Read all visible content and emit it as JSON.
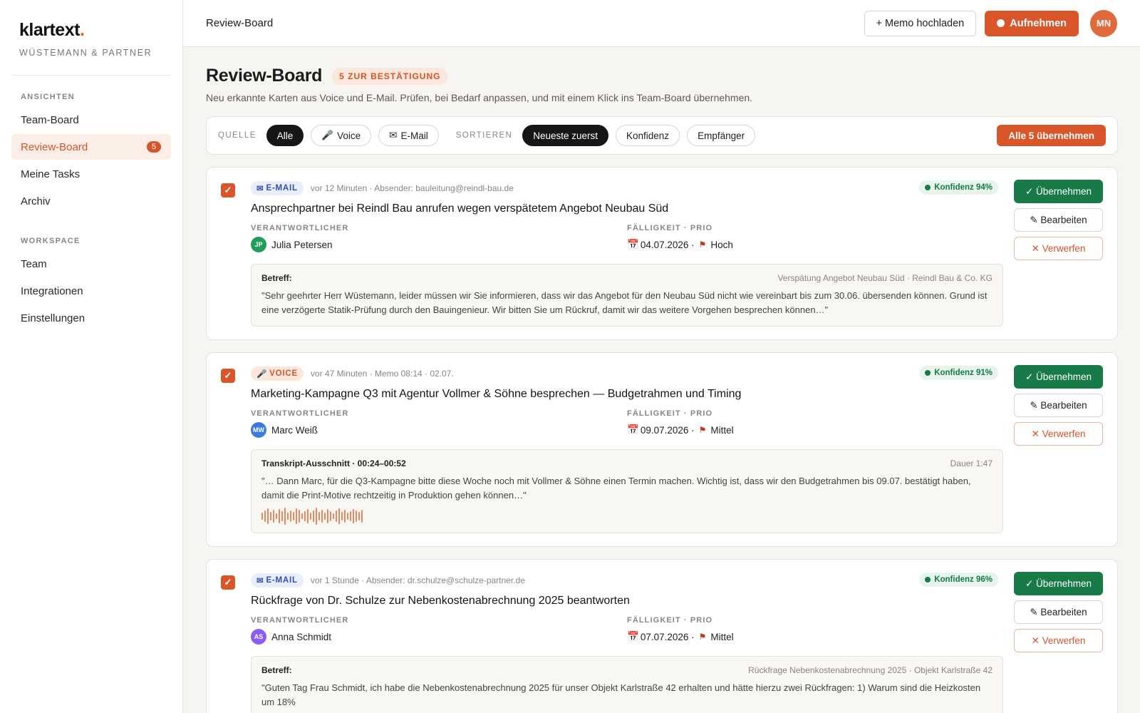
{
  "brand": {
    "logo": "klartext",
    "logo_dot": ".",
    "company": "WÜSTEMANN & PARTNER"
  },
  "sidebar": {
    "groups": [
      {
        "heading": "ANSICHTEN",
        "items": [
          {
            "label": "Team-Board"
          },
          {
            "label": "Review-Board",
            "badge": "5",
            "active": true
          },
          {
            "label": "Meine Tasks"
          },
          {
            "label": "Archiv"
          }
        ]
      },
      {
        "heading": "WORKSPACE",
        "items": [
          {
            "label": "Team"
          },
          {
            "label": "Integrationen"
          },
          {
            "label": "Einstellungen"
          }
        ]
      }
    ]
  },
  "topbar": {
    "title": "Review-Board",
    "upload_label": "+ Memo hochladen",
    "record_label": "Aufnehmen",
    "avatar": "MN"
  },
  "page": {
    "title": "Review-Board",
    "badge": "5 ZUR BESTÄTIGUNG",
    "subtitle": "Neu erkannte Karten aus Voice und E-Mail. Prüfen, bei Bedarf anpassen, und mit einem Klick ins Team-Board übernehmen."
  },
  "filters": {
    "source_label": "QUELLE",
    "source_options": [
      {
        "label": "Alle",
        "icon": "",
        "active": true
      },
      {
        "label": "Voice",
        "icon": "🎤",
        "active": false
      },
      {
        "label": "E-Mail",
        "icon": "✉",
        "active": false
      }
    ],
    "sort_label": "SORTIEREN",
    "sort_options": [
      {
        "label": "Neueste zuerst",
        "active": true
      },
      {
        "label": "Konfidenz",
        "active": false
      },
      {
        "label": "Empfänger",
        "active": false
      }
    ],
    "accept_all_label": "Alle 5 übernehmen"
  },
  "card_labels": {
    "owner": "VERANTWORTLICHER",
    "due": "FÄLLIGKEIT · PRIO",
    "accept": "✓ Übernehmen",
    "edit": "✎ Bearbeiten",
    "reject": "✕ Verwerfen",
    "calendar_icon": "📅",
    "flag_icon": "⚑"
  },
  "cards": [
    {
      "type": "email",
      "source_icon": "✉",
      "source_label": "E-MAIL",
      "meta": "vor 12 Minuten · Absender: bauleitung@reindl-bau.de",
      "confidence": "Konfidenz 94%",
      "title": "Ansprechpartner bei Reindl Bau anrufen wegen verspätetem Angebot Neubau Süd",
      "owner_initials": "JP",
      "owner_color": "#1f9d5b",
      "owner_name": "Julia Petersen",
      "due": "04.07.2026 ·",
      "prio": "Hoch",
      "quote_label": "Betreff:",
      "quote_ref": "Verspätung Angebot Neubau Süd · Reindl Bau & Co. KG",
      "quote_text": "\"Sehr geehrter Herr Wüstemann, leider müssen wir Sie informieren, dass wir das Angebot für den Neubau Süd nicht wie vereinbart bis zum 30.06. übersenden können. Grund ist eine verzögerte Statik-Prüfung durch den Bauingenieur. Wir bitten Sie um Rückruf, damit wir das weitere Vorgehen besprechen können…\""
    },
    {
      "type": "voice",
      "source_icon": "🎤",
      "source_label": "VOICE",
      "meta": "vor 47 Minuten · Memo 08:14 · 02.07.",
      "confidence": "Konfidenz 91%",
      "title": "Marketing-Kampagne Q3 mit Agentur Vollmer & Söhne besprechen — Budgetrahmen und Timing",
      "owner_initials": "MW",
      "owner_color": "#3b7be0",
      "owner_name": "Marc Weiß",
      "due": "09.07.2026 ·",
      "prio": "Mittel",
      "quote_label": "Transkript-Ausschnitt · 00:24–00:52",
      "quote_ref": "Dauer 1:47",
      "quote_text": "\"… Dann Marc, für die Q3-Kampagne bitte diese Woche noch mit Vollmer & Söhne einen Termin machen. Wichtig ist, dass wir den Budgetrahmen bis 09.07. bestätigt haben, damit die Print-Motive rechtzeitig in Produktion gehen können…\""
    },
    {
      "type": "email",
      "source_icon": "✉",
      "source_label": "E-MAIL",
      "meta": "vor 1 Stunde · Absender: dr.schulze@schulze-partner.de",
      "confidence": "Konfidenz 96%",
      "title": "Rückfrage von Dr. Schulze zur Nebenkostenabrechnung 2025 beantworten",
      "owner_initials": "AS",
      "owner_color": "#8b5cf6",
      "owner_name": "Anna Schmidt",
      "due": "07.07.2026 ·",
      "prio": "Mittel",
      "quote_label": "Betreff:",
      "quote_ref": "Rückfrage Nebenkostenabrechnung 2025 · Objekt Karlstraße 42",
      "quote_text": "\"Guten Tag Frau Schmidt, ich habe die Nebenkostenabrechnung 2025 für unser Objekt Karlstraße 42 erhalten und hätte hierzu zwei Rückfragen: 1) Warum sind die Heizkosten um 18%"
    }
  ]
}
